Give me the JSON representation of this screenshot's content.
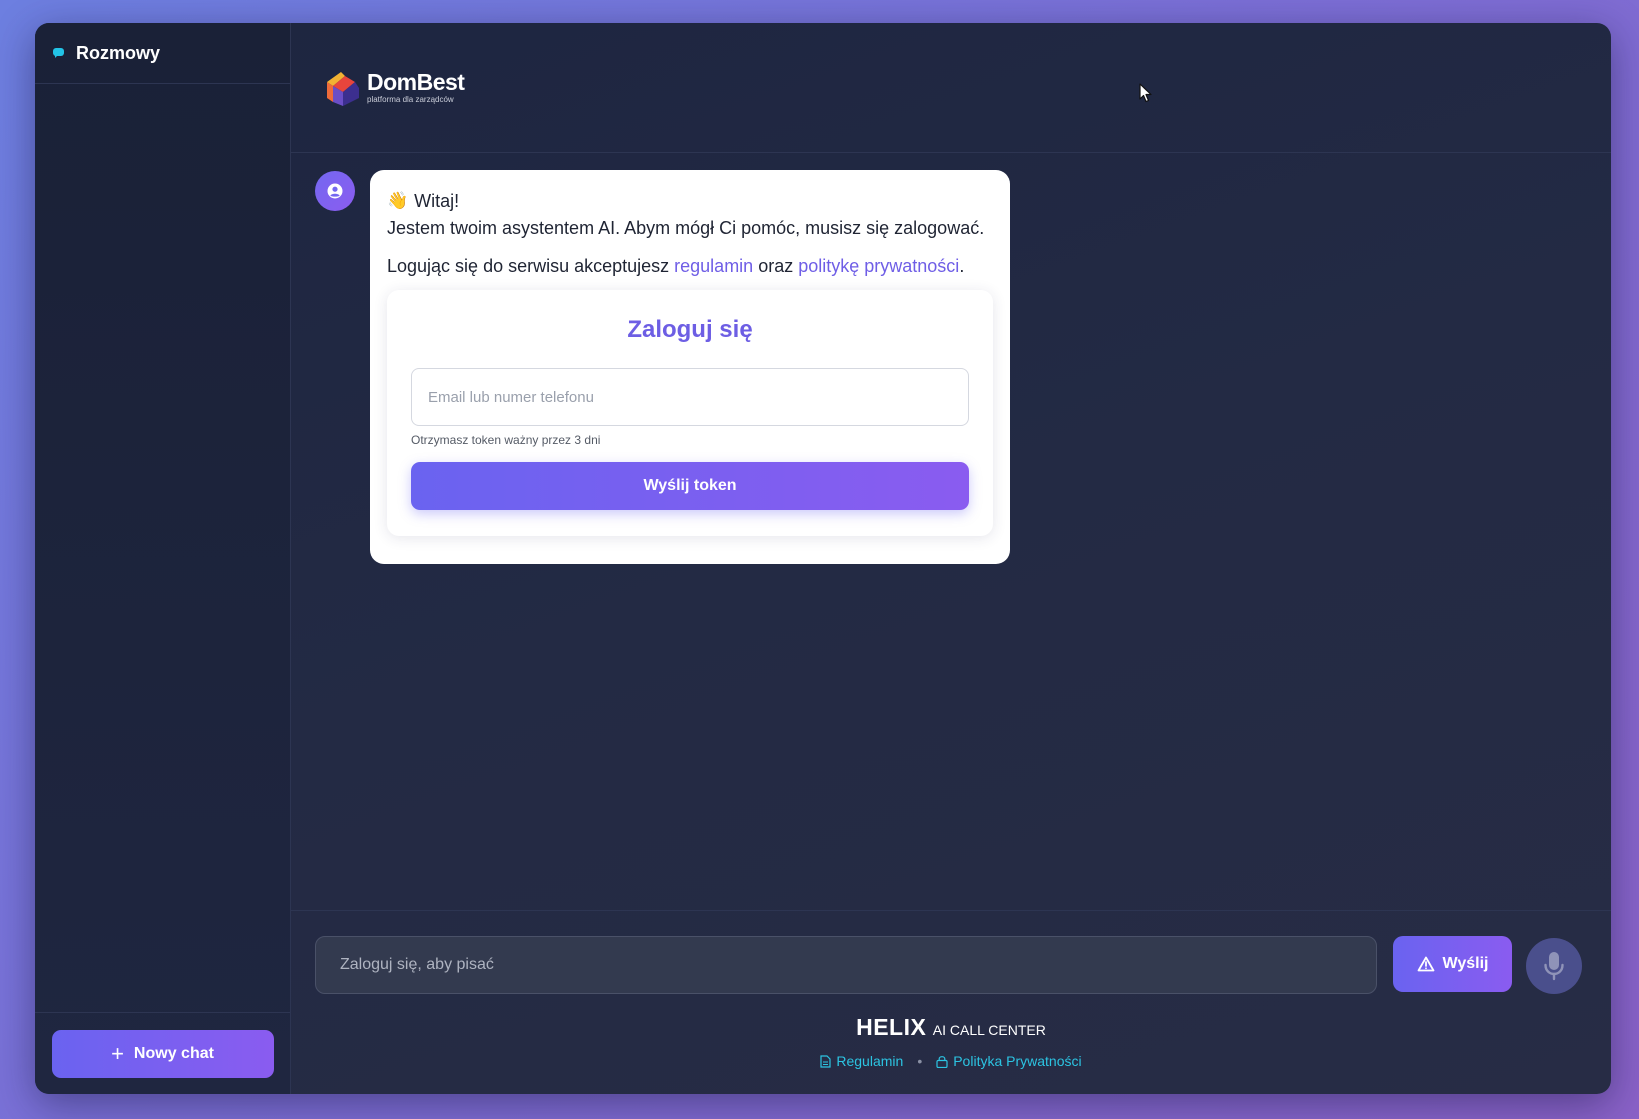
{
  "sidebar": {
    "title": "Rozmowy",
    "new_chat_label": "Nowy chat"
  },
  "header": {
    "logo_name": "DomBest",
    "logo_sub": "platforma dla zarządców"
  },
  "message": {
    "greeting": "Witaj!",
    "intro": "Jestem twoim asystentem AI. Abym mógł Ci pomóc, musisz się zalogować.",
    "terms_prefix": "Logując się do serwisu akceptujesz ",
    "terms_link": "regulamin",
    "terms_middle": " oraz ",
    "privacy_link": "politykę prywatności",
    "terms_suffix": "."
  },
  "login": {
    "title": "Zaloguj się",
    "email_value": "",
    "email_placeholder": "Email lub numer telefonu",
    "hint": "Otrzymasz token ważny przez 3 dni",
    "submit_label": "Wyślij token"
  },
  "composer": {
    "value": "",
    "placeholder": "Zaloguj się, aby pisać",
    "send_label": "Wyślij"
  },
  "brand": {
    "name": "HELIX",
    "sub": "AI CALL CENTER"
  },
  "footer": {
    "terms_label": "Regulamin",
    "privacy_label": "Polityka Prywatności"
  },
  "icons": {
    "chat": "chat-bubble-icon",
    "plus": "plus-icon",
    "avatar": "user-circle-icon",
    "wave": "waving-hand-icon",
    "send": "send-triangle-icon",
    "mic": "microphone-icon",
    "doc": "document-icon",
    "lock": "lock-icon"
  },
  "colors": {
    "accent": "#6a63f0",
    "accent_end": "#8a5cf0",
    "link": "#6f5ee6",
    "footer_link": "#2cc4e2",
    "background": "#1f2640"
  }
}
